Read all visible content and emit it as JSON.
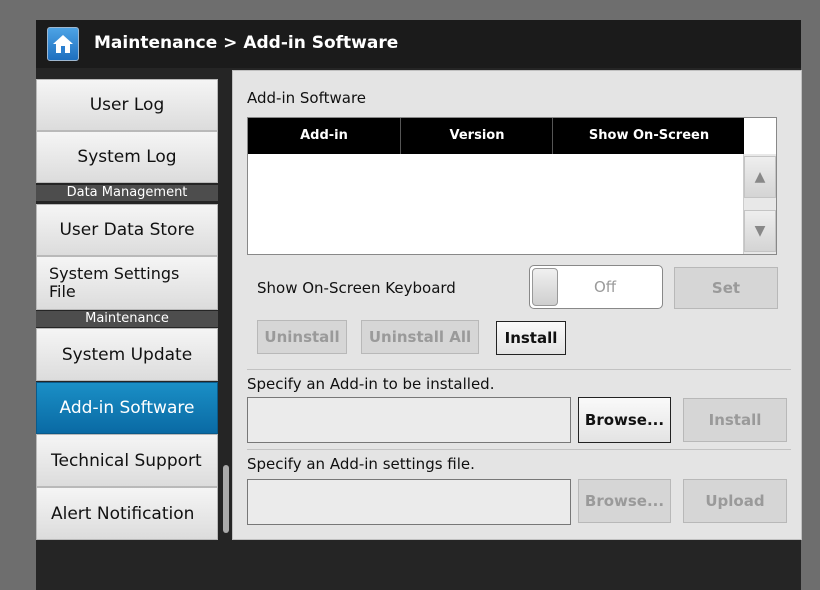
{
  "header": {
    "title": "Maintenance > Add-in Software",
    "home_icon": "home-icon"
  },
  "sidebar": {
    "items": [
      {
        "label": "User Log"
      },
      {
        "label": "System Log"
      },
      {
        "label": "Data Management"
      },
      {
        "label": "User Data Store"
      },
      {
        "label": "System Settings File"
      },
      {
        "label": "Maintenance"
      },
      {
        "label": "System Update"
      },
      {
        "label": "Add-in Software"
      },
      {
        "label": "Technical Support"
      },
      {
        "label": "Alert Notification"
      }
    ],
    "active_item": "Add-in Software"
  },
  "main": {
    "section_title": "Add-in Software",
    "table": {
      "columns": [
        "Add-in",
        "Version",
        "Show On-Screen Keyboard"
      ],
      "rows": []
    },
    "keyboard": {
      "label": "Show On-Screen Keyboard",
      "toggle_state": "Off",
      "set_label": "Set"
    },
    "actions": {
      "uninstall": "Uninstall",
      "uninstall_all": "Uninstall All",
      "install": "Install"
    },
    "install_addin": {
      "label": "Specify an Add-in to be installed.",
      "browse": "Browse...",
      "install": "Install"
    },
    "settings_file": {
      "label": "Specify an Add-in settings file.",
      "browse": "Browse...",
      "upload": "Upload"
    }
  },
  "colors": {
    "active": "#0a79b6",
    "header_bg": "#1b1b1b",
    "panel_bg": "#e4e4e4"
  }
}
